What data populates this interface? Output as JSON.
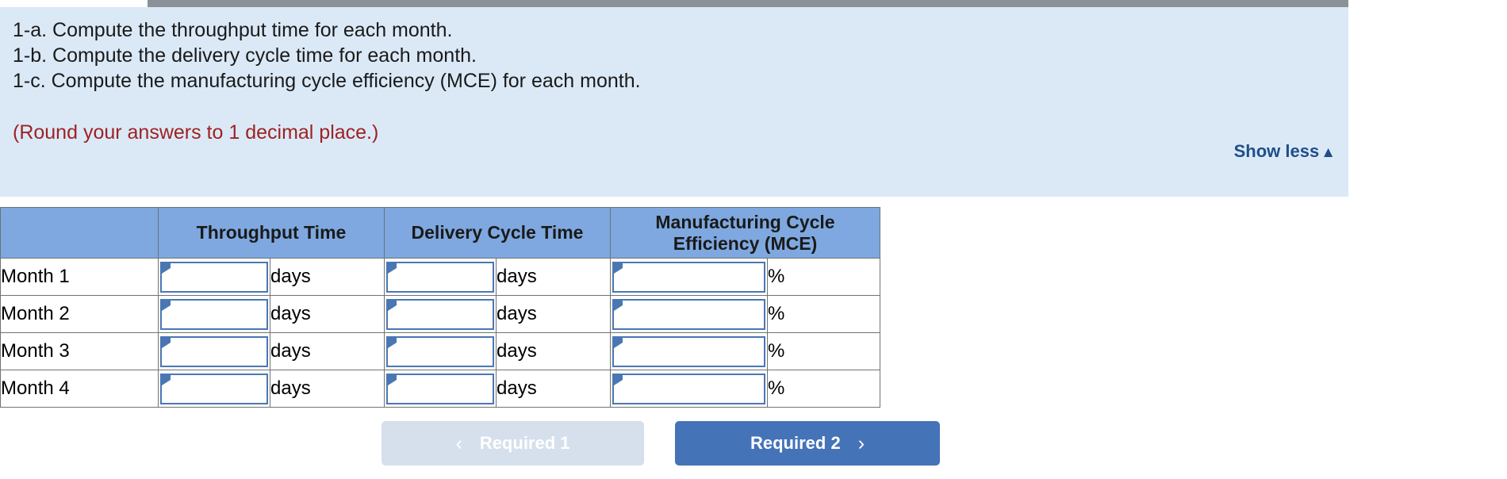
{
  "instructions": {
    "lines": [
      "1-a. Compute the throughput time for each month.",
      "1-b. Compute the delivery cycle time for each month.",
      "1-c. Compute the manufacturing cycle efficiency (MCE) for each month."
    ],
    "round_note": "(Round your answers to 1 decimal place.)",
    "show_less_label": "Show less",
    "show_less_caret": "▲",
    "panel_bg": "#dbe9f7",
    "note_color": "#9e2222",
    "link_color": "#1f4e88"
  },
  "table": {
    "header_bg": "#7ea8df",
    "columns": [
      {
        "label": "",
        "unit": ""
      },
      {
        "label": "Throughput Time",
        "unit": "days"
      },
      {
        "label": "Delivery Cycle Time",
        "unit": "days"
      },
      {
        "label": "Manufacturing Cycle Efficiency (MCE)",
        "unit": "%"
      }
    ],
    "rows": [
      {
        "label": "Month 1",
        "throughput_time": "",
        "delivery_cycle_time": "",
        "mce": ""
      },
      {
        "label": "Month 2",
        "throughput_time": "",
        "delivery_cycle_time": "",
        "mce": ""
      },
      {
        "label": "Month 3",
        "throughput_time": "",
        "delivery_cycle_time": "",
        "mce": ""
      },
      {
        "label": "Month 4",
        "throughput_time": "",
        "delivery_cycle_time": "",
        "mce": ""
      }
    ],
    "input_placeholder": ""
  },
  "footer": {
    "prev": {
      "label": "Required 1",
      "chevron": "‹",
      "bg": "#d6dfec",
      "disabled": true
    },
    "next": {
      "label": "Required 2",
      "chevron": "›",
      "bg": "#4573b8",
      "disabled": false
    }
  }
}
